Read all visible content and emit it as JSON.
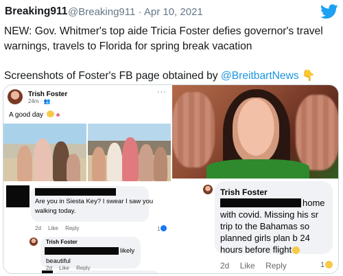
{
  "tweet": {
    "author_name": "Breaking911",
    "handle": "@Breaking911",
    "separator": "·",
    "date": "Apr 10, 2021",
    "text_line1": "NEW: Gov. Whitmer's top aide Tricia Foster defies governor's travel",
    "text_line2": "warnings, travels to Florida for spring break vacation",
    "text_line3_prefix": "Screenshots of Foster's FB page obtained by ",
    "mention": "@BreitbartNews",
    "pointing_emoji": "👇",
    "brand_color": "#1da1f2",
    "mention_color": "#1b95e0"
  },
  "fb_post": {
    "author": "Trish Foster",
    "time": "24m · ",
    "more": "···",
    "caption": "A good day "
  },
  "fb_comments_left": {
    "comment1_line1": "Are you in Siesta Key? I swear I saw you",
    "comment1_line2": "walking today.",
    "comment1_age": "2d",
    "comment1_like": "Like",
    "comment1_reply": "Reply",
    "comment1_reactions": "1",
    "reply_author": "Trish Foster",
    "reply_word1": "likely",
    "reply_word2": "beautiful",
    "reply_age": "2d",
    "reply_like": "Like",
    "reply_reply": "Reply"
  },
  "fb_comment_right": {
    "author": "Trish Foster",
    "line1_end": "home",
    "line2": "with covid. Missing his sr",
    "line3": "trip to the Bahamas so",
    "line4": "planned girls plan b 24",
    "line5": "hours before flight",
    "age": "2d",
    "like": "Like",
    "reply": "Reply",
    "reactions": "1"
  }
}
